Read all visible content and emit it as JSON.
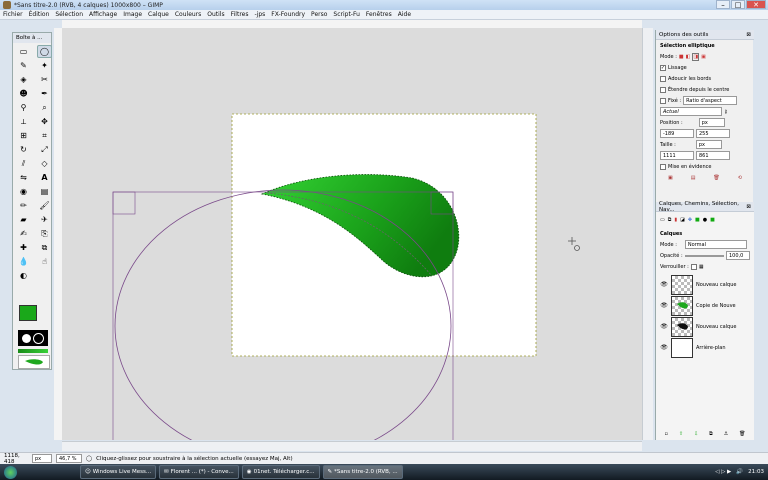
{
  "window": {
    "title": "*Sans titre-2.0 (RVB, 4 calques) 1000x800 – GIMP"
  },
  "menu": [
    "Fichier",
    "Édition",
    "Sélection",
    "Affichage",
    "Image",
    "Calque",
    "Couleurs",
    "Outils",
    "Filtres",
    "-jps",
    "FX-Foundry",
    "Perso",
    "Script-Fu",
    "Fenêtres",
    "Aide"
  ],
  "toolbox": {
    "title": "Boîte à ..."
  },
  "tool_options": {
    "title": "Options des outils",
    "tool_name": "Sélection elliptique",
    "mode_label": "Mode :",
    "lissage": "Lissage",
    "adoucir": "Adoucir les bords",
    "etendre": "Étendre depuis le centre",
    "fixe": "Fixé :",
    "fixe_value": "Ratio d'aspect",
    "actuel": "Actuel",
    "position_label": "Position :",
    "position_unit": "px",
    "pos_x": "-189",
    "pos_y": "255",
    "taille_label": "Taille :",
    "taille_unit": "px",
    "size_w": "1111",
    "size_h": "861",
    "mise": "Mise en évidence"
  },
  "layers_panel": {
    "title": "Calques, Chemins, Sélection, Nav...",
    "sub_title": "Calques",
    "mode_label": "Mode :",
    "mode_value": "Normal",
    "opacity_label": "Opacité :",
    "opacity_value": "100,0",
    "lock_label": "Verrouiller :",
    "layers": [
      {
        "name": "Nouveau calque"
      },
      {
        "name": "Copie de Nouve"
      },
      {
        "name": "Nouveau calque"
      },
      {
        "name": "Arrière-plan"
      }
    ]
  },
  "status": {
    "coords": "1118, 418",
    "unit": "px",
    "zoom": "46,7 %",
    "message": "Cliquez-glissez pour soustraire à la sélection actuelle (essayez Maj, Alt)"
  },
  "taskbar": {
    "items": [
      "Windows Live Mess...",
      "Florent ... (*) - Conve...",
      "01net. Télécharger.c...",
      "*Sans titre-2.0 (RVB, ..."
    ],
    "clock": "21:03"
  },
  "colors": {
    "leaf_dark": "#0f7d0f",
    "leaf_light": "#2ec82e",
    "selection": "#7a4a8a"
  }
}
